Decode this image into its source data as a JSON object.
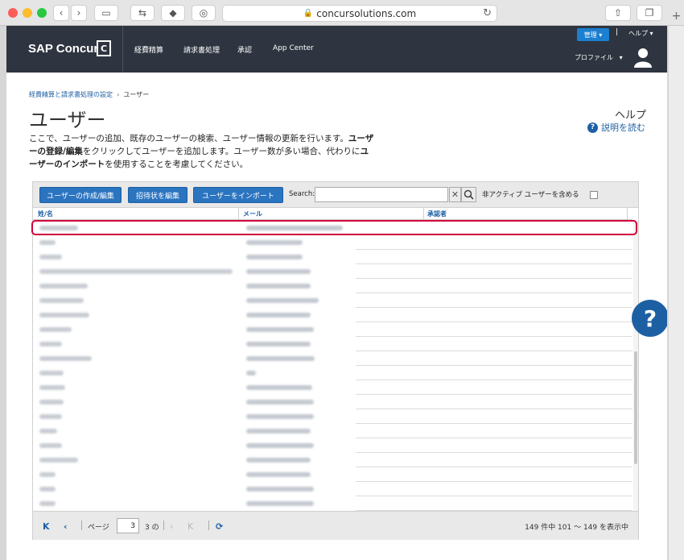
{
  "browser": {
    "url": "concursolutions.com"
  },
  "nav": {
    "logo": "SAP Concur",
    "logo_mark": "C",
    "items": [
      "経費精算",
      "請求書処理",
      "承認",
      "App Center"
    ],
    "admin_label": "管理",
    "help_label": "ヘルプ",
    "profile_label": "プロファイル"
  },
  "breadcrumb": {
    "parent": "経費精算と請求書処理の設定",
    "current": "ユーザー"
  },
  "page": {
    "title": "ユーザー",
    "help_heading": "ヘルプ",
    "read_link": "説明を読む",
    "desc_1": "ここで、ユーザーの追加、既存のユーザーの検索、ユーザー情報の更新を行います。",
    "desc_b1": "ユーザーの登録/編集",
    "desc_2": "をクリックしてユーザーを追加します。ユーザー数が多い場合、代わりに",
    "desc_b2": "ユーザーのインポート",
    "desc_3": "を使用することを考慮してください。"
  },
  "toolbar": {
    "create_edit": "ユーザーの作成/編集",
    "edit_invite": "招待状を編集",
    "import": "ユーザーをインポート",
    "search_label": "Search:",
    "search_value": "",
    "inactive_label": "非アクティブ ユーザーを含める",
    "inactive_checked": false
  },
  "grid": {
    "columns": [
      "姓/名",
      "メール",
      "承認者"
    ]
  },
  "pager": {
    "page_label": "ページ",
    "page_value": "3",
    "of_label": "3 の",
    "summary": "149 件中 101 〜 149 を表示中"
  },
  "icons": {
    "first": "first-page-icon",
    "prev": "prev-page-icon",
    "next": "next-page-icon",
    "last": "last-page-icon",
    "refresh": "refresh-icon"
  }
}
